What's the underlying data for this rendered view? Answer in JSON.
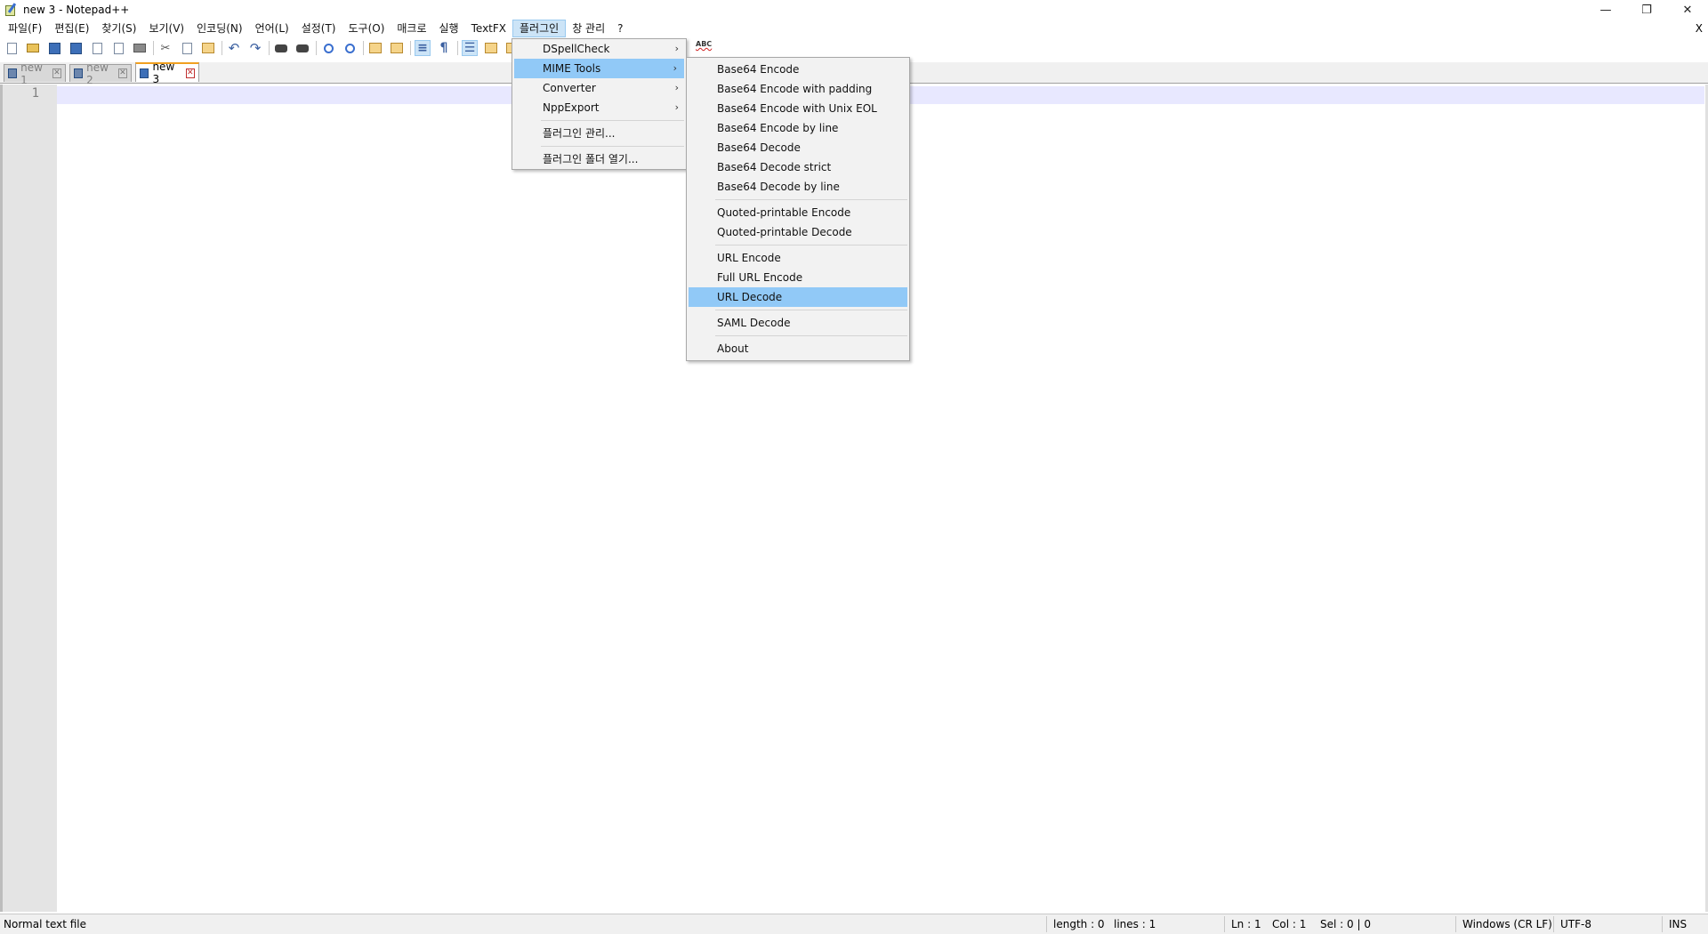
{
  "window": {
    "title": "new 3 - Notepad++",
    "controls": {
      "minimize": "—",
      "restore": "❐",
      "close": "✕"
    }
  },
  "menubar": {
    "items": [
      "파일(F)",
      "편집(E)",
      "찾기(S)",
      "보기(V)",
      "인코딩(N)",
      "언어(L)",
      "설정(T)",
      "도구(O)",
      "매크로",
      "실행",
      "TextFX",
      "플러그인",
      "창 관리",
      "?"
    ],
    "active": "플러그인",
    "close_doc": "X"
  },
  "toolbar": {
    "icons": [
      "new-file-icon",
      "open-folder-icon",
      "save-icon",
      "save-all-icon",
      "close-icon",
      "close-all-icon",
      "print-icon",
      "cut-icon",
      "copy-icon",
      "paste-icon",
      "undo-icon",
      "redo-icon",
      "find-icon",
      "replace-icon",
      "zoom-in-icon",
      "zoom-out-icon",
      "sync-vertical-icon",
      "sync-horizontal-icon",
      "word-wrap-icon",
      "show-all-chars-icon",
      "indent-guide-icon",
      "doc-map-icon",
      "function-list-icon"
    ],
    "spellcheck_label": "ABC"
  },
  "tabs": [
    {
      "label": "new 1",
      "active": false
    },
    {
      "label": "new 2",
      "active": false
    },
    {
      "label": "new 3",
      "active": true
    }
  ],
  "editor": {
    "line_numbers": [
      "1"
    ],
    "content": ""
  },
  "plugins_menu": {
    "items": [
      {
        "label": "DSpellCheck",
        "submenu": true
      },
      {
        "label": "MIME Tools",
        "submenu": true,
        "highlighted": true
      },
      {
        "label": "Converter",
        "submenu": true
      },
      {
        "label": "NppExport",
        "submenu": true
      },
      {
        "label": "플러그인 관리...",
        "submenu": false
      },
      {
        "label": "플러그인 폴더 열기...",
        "submenu": false
      }
    ]
  },
  "mime_menu": {
    "groups": [
      [
        "Base64 Encode",
        "Base64 Encode with padding",
        "Base64 Encode with Unix EOL",
        "Base64 Encode by line",
        "Base64 Decode",
        "Base64 Decode strict",
        "Base64 Decode by line"
      ],
      [
        "Quoted-printable Encode",
        "Quoted-printable Decode"
      ],
      [
        "URL Encode",
        "Full URL Encode",
        "URL Decode"
      ],
      [
        "SAML Decode"
      ],
      [
        "About"
      ]
    ],
    "highlighted": "URL Decode"
  },
  "statusbar": {
    "file_type": "Normal text file",
    "length": "length : 0",
    "lines": "lines : 1",
    "ln": "Ln : 1",
    "col": "Col : 1",
    "sel": "Sel : 0 | 0",
    "eol": "Windows (CR LF)",
    "encoding": "UTF-8",
    "mode": "INS"
  },
  "colors": {
    "menu_highlight": "#91c9f7",
    "current_line": "#e8e8ff",
    "gutter": "#e4e4e4"
  }
}
